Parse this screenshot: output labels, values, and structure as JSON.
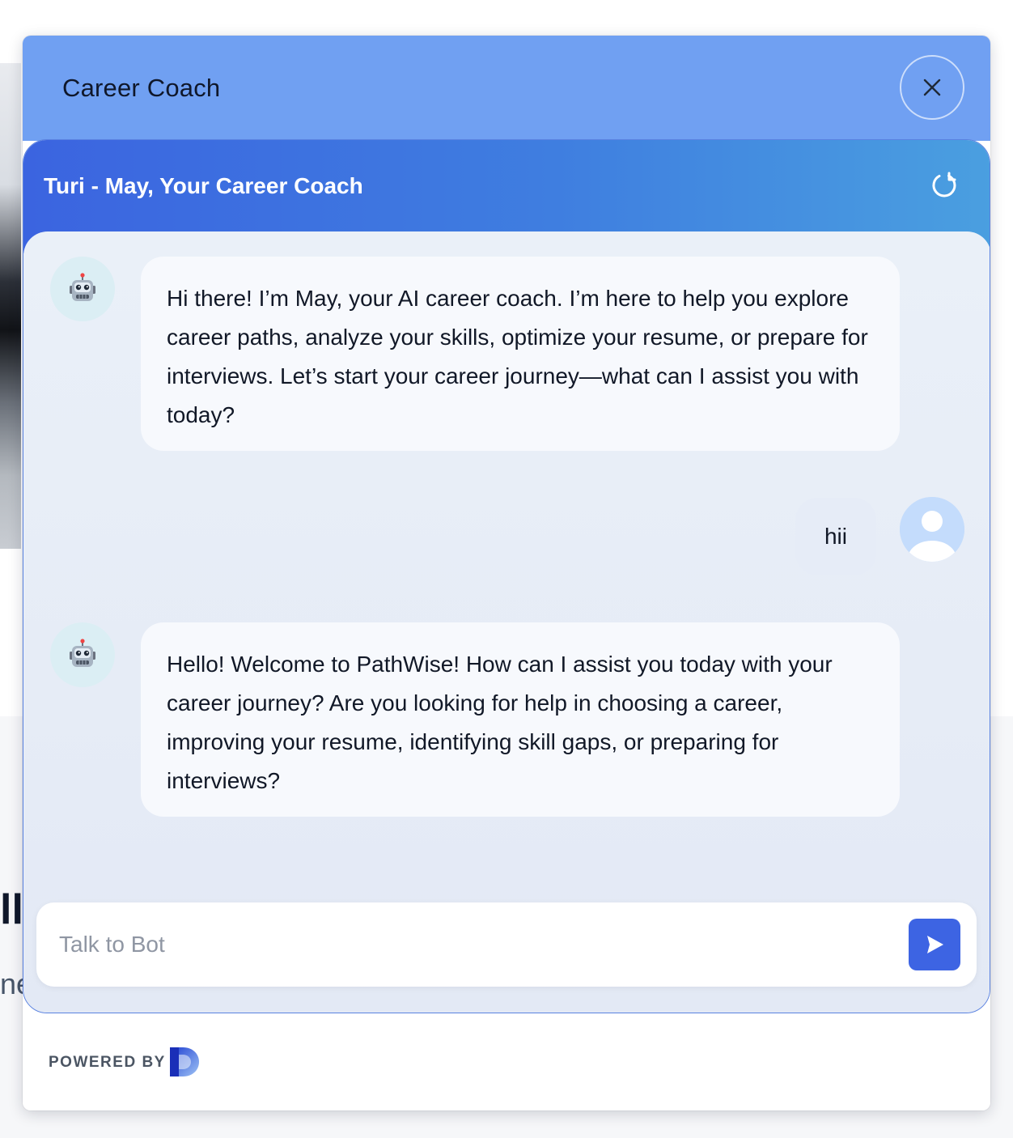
{
  "background": {
    "heading_fragment": "ll",
    "body_fragment": "ne"
  },
  "widget": {
    "title": "Career Coach",
    "close_icon": "close-icon"
  },
  "chat": {
    "title": "Turi - May, Your Career Coach",
    "refresh_icon": "refresh-icon",
    "messages": [
      {
        "sender": "bot",
        "avatar": "robot-emoji",
        "text": "Hi there! I’m May, your AI career coach. I’m here to help you explore career paths, analyze your skills, optimize your resume, or prepare for interviews. Let’s start your career journey—what can I assist you with today?"
      },
      {
        "sender": "user",
        "avatar": "user-icon",
        "text": "hii"
      },
      {
        "sender": "bot",
        "avatar": "robot-emoji",
        "text": "Hello! Welcome to PathWise! How can I assist you today with your career journey? Are you looking for help in choosing a career, improving your resume, identifying skill gaps, or preparing for interviews?"
      }
    ],
    "input": {
      "placeholder": "Talk to Bot",
      "value": ""
    },
    "send_icon": "send-icon"
  },
  "footer": {
    "powered_by": "POWERED BY",
    "logo": "brand-logo"
  },
  "colors": {
    "header": "#70a0f2",
    "chat_header_start": "#3b64e0",
    "chat_header_end": "#4a9fe0",
    "send_button": "#3d64e3"
  }
}
